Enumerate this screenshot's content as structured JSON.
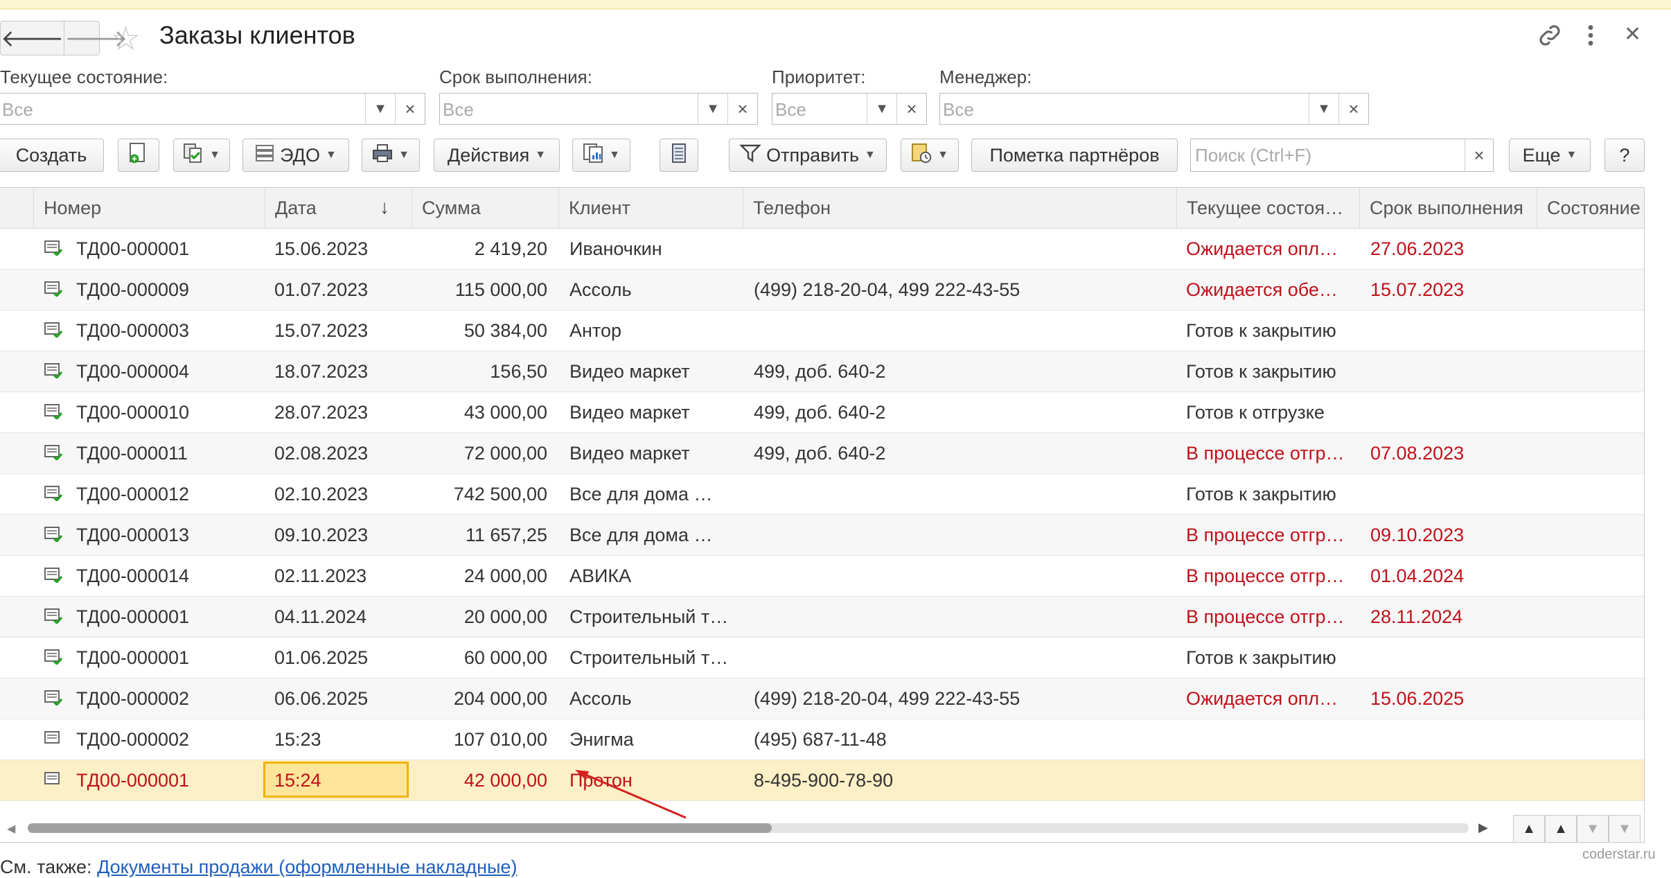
{
  "window": {
    "title": "Заказы клиентов",
    "back_icon": "arrow-left-icon",
    "forward_icon": "arrow-right-icon",
    "favorite_icon": "star-icon",
    "link_icon": "link-icon",
    "more_icon": "more-vertical-icon",
    "close_icon": "close-icon"
  },
  "filters": [
    {
      "label": "Текущее состояние:",
      "placeholder": "Все"
    },
    {
      "label": "Срок выполнения:",
      "placeholder": "Все"
    },
    {
      "label": "Приоритет:",
      "placeholder": "Все"
    },
    {
      "label": "Менеджер:",
      "placeholder": "Все"
    }
  ],
  "toolbar": {
    "create": "Создать",
    "edo": "ЭДО",
    "actions": "Действия",
    "send": "Отправить",
    "partner_mark": "Пометка партнёров",
    "search_placeholder": "Поиск (Ctrl+F)",
    "more": "Еще",
    "help": "?"
  },
  "table": {
    "columns": [
      "Номер",
      "Дата",
      "Сумма",
      "Клиент",
      "Телефон",
      "Текущее состоя…",
      "Срок выполнения",
      "Состояние"
    ],
    "sort_indicator": "↓",
    "rows": [
      {
        "number": "ТД00-000001",
        "date": "15.06.2023",
        "sum": "2 419,20",
        "client": "Иваночкин",
        "phone": "",
        "state": "Ожидается опл…",
        "deadline": "27.06.2023",
        "red_state": true,
        "posted": true
      },
      {
        "number": "ТД00-000009",
        "date": "01.07.2023",
        "sum": "115 000,00",
        "client": "Ассоль",
        "phone": "(499) 218-20-04, 499 222-43-55",
        "state": "Ожидается обе…",
        "deadline": "15.07.2023",
        "red_state": true,
        "posted": true
      },
      {
        "number": "ТД00-000003",
        "date": "15.07.2023",
        "sum": "50 384,00",
        "client": "Антор",
        "phone": "",
        "state": "Готов к закрытию",
        "deadline": "",
        "red_state": false,
        "posted": true
      },
      {
        "number": "ТД00-000004",
        "date": "18.07.2023",
        "sum": "156,50",
        "client": "Видео маркет",
        "phone": "499, доб. 640-2",
        "state": "Готов к закрытию",
        "deadline": "",
        "red_state": false,
        "posted": true
      },
      {
        "number": "ТД00-000010",
        "date": "28.07.2023",
        "sum": "43 000,00",
        "client": "Видео маркет",
        "phone": "499, доб. 640-2",
        "state": "Готов к отгрузке",
        "deadline": "",
        "red_state": false,
        "posted": true
      },
      {
        "number": "ТД00-000011",
        "date": "02.08.2023",
        "sum": "72 000,00",
        "client": "Видео маркет",
        "phone": "499, доб. 640-2",
        "state": "В процессе отгр…",
        "deadline": "07.08.2023",
        "red_state": true,
        "posted": true
      },
      {
        "number": "ТД00-000012",
        "date": "02.10.2023",
        "sum": "742 500,00",
        "client": "Все для дома …",
        "phone": "",
        "state": "Готов к закрытию",
        "deadline": "",
        "red_state": false,
        "posted": true
      },
      {
        "number": "ТД00-000013",
        "date": "09.10.2023",
        "sum": "11 657,25",
        "client": "Все для дома …",
        "phone": "",
        "state": "В процессе отгр…",
        "deadline": "09.10.2023",
        "red_state": true,
        "posted": true
      },
      {
        "number": "ТД00-000014",
        "date": "02.11.2023",
        "sum": "24 000,00",
        "client": "АВИКА",
        "phone": "",
        "state": "В процессе отгр…",
        "deadline": "01.04.2024",
        "red_state": true,
        "posted": true
      },
      {
        "number": "ТД00-000001",
        "date": "04.11.2024",
        "sum": "20 000,00",
        "client": "Строительный т…",
        "phone": "",
        "state": "В процессе отгр…",
        "deadline": "28.11.2024",
        "red_state": true,
        "posted": true
      },
      {
        "number": "ТД00-000001",
        "date": "01.06.2025",
        "sum": "60 000,00",
        "client": "Строительный т…",
        "phone": "",
        "state": "Готов к закрытию",
        "deadline": "",
        "red_state": false,
        "posted": true
      },
      {
        "number": "ТД00-000002",
        "date": "06.06.2025",
        "sum": "204 000,00",
        "client": "Ассоль",
        "phone": "(499) 218-20-04, 499 222-43-55",
        "state": "Ожидается опл…",
        "deadline": "15.06.2025",
        "red_state": true,
        "posted": true
      },
      {
        "number": "ТД00-000002",
        "date": "15:23",
        "sum": "107 010,00",
        "client": "Энигма",
        "phone": "(495) 687-11-48",
        "state": "",
        "deadline": "",
        "red_state": false,
        "posted": false
      },
      {
        "number": "ТД00-000001",
        "date": "15:24",
        "sum": "42 000,00",
        "client": "Протон",
        "phone": "8-495-900-78-90",
        "state": "",
        "deadline": "",
        "red_state": false,
        "posted": false,
        "selected": true
      }
    ]
  },
  "footer": {
    "see_also_label": "См. также:",
    "see_also_link": "Документы продажи (оформленные накладные)",
    "watermark": "coderstar.ru"
  },
  "colors": {
    "accent_red": "#c0111a",
    "selection": "#fdf0c6",
    "link": "#1f5fbf"
  }
}
